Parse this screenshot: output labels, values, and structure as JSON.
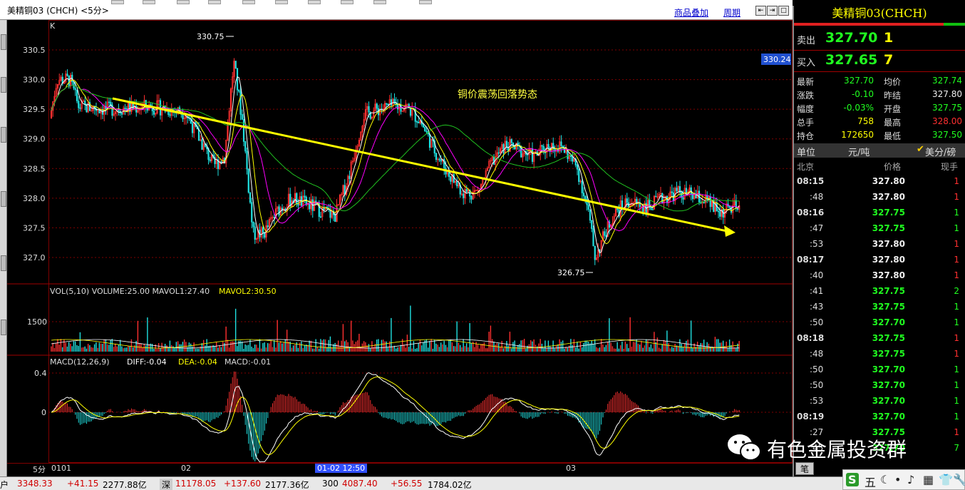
{
  "window": {
    "title": "美精铜03 (CHCH) <5分>",
    "links": [
      "商品叠加",
      "周期"
    ],
    "nav_buttons": [
      "⇤",
      "⇥",
      "□"
    ]
  },
  "chart": {
    "k_label": "K",
    "annotation_text": "铜价震荡回落势态",
    "high_label": "330.75",
    "low_label": "326.75",
    "current_price_tag": "330.24",
    "price_axis": [
      "330.5",
      "330.0",
      "329.5",
      "329.0",
      "328.5",
      "328.0",
      "327.5",
      "327.0"
    ],
    "vol_header": {
      "prefix": "VOL(5,10) VOLUME:25.00 MAVOL1:27.40",
      "mavol2": "MAVOL2:30.50"
    },
    "vol_axis": [
      "1500"
    ],
    "macd_header": {
      "prefix": "MACD(12,26,9)",
      "diff": "DIFF:-0.04",
      "dea": "DEA:-0.04",
      "macd": "MACD:-0.01"
    },
    "macd_axis": [
      "0.4",
      "0"
    ]
  },
  "x_axis": {
    "period": "5分",
    "labels": [
      "0101",
      "02",
      "03"
    ],
    "cursor": "01-02 12:50"
  },
  "quote": {
    "title": "美精铜03(CHCH)",
    "sell_label": "卖出",
    "sell_price": "327.70",
    "sell_qty": "1",
    "buy_label": "买入",
    "buy_price": "327.65",
    "buy_qty": "7",
    "rows": [
      {
        "l1": "最新",
        "v1": "327.70",
        "c1": "green",
        "l2": "均价",
        "v2": "327.74",
        "c2": "green"
      },
      {
        "l1": "涨跌",
        "v1": "-0.10",
        "c1": "green",
        "l2": "昨结",
        "v2": "327.80",
        "c2": "white"
      },
      {
        "l1": "幅度",
        "v1": "-0.03%",
        "c1": "green",
        "l2": "开盘",
        "v2": "327.75",
        "c2": "green"
      },
      {
        "l1": "总手",
        "v1": "758",
        "c1": "yellow",
        "l2": "最高",
        "v2": "328.00",
        "c2": "red"
      },
      {
        "l1": "持仓",
        "v1": "172650",
        "c1": "yellow",
        "l2": "最低",
        "v2": "327.50",
        "c2": "green"
      }
    ],
    "unit_label": "单位",
    "unit_value": "元/吨",
    "unit_alt": "美分/磅",
    "trade_header": {
      "loc": "北京",
      "price": "价格",
      "qty": "现手"
    },
    "trades": [
      {
        "t": "08:15",
        "bold": true,
        "p": "327.80",
        "pc": "white",
        "q": "1",
        "qc": "red"
      },
      {
        "t": ":48",
        "bold": false,
        "p": "327.80",
        "pc": "white",
        "q": "1",
        "qc": "red"
      },
      {
        "t": "08:16",
        "bold": true,
        "p": "327.75",
        "pc": "green",
        "q": "1",
        "qc": "green"
      },
      {
        "t": ":47",
        "bold": false,
        "p": "327.75",
        "pc": "green",
        "q": "1",
        "qc": "green"
      },
      {
        "t": ":53",
        "bold": false,
        "p": "327.80",
        "pc": "white",
        "q": "1",
        "qc": "red"
      },
      {
        "t": "08:17",
        "bold": true,
        "p": "327.80",
        "pc": "white",
        "q": "1",
        "qc": "red"
      },
      {
        "t": ":40",
        "bold": false,
        "p": "327.80",
        "pc": "white",
        "q": "1",
        "qc": "red"
      },
      {
        "t": ":41",
        "bold": false,
        "p": "327.75",
        "pc": "green",
        "q": "2",
        "qc": "green"
      },
      {
        "t": ":43",
        "bold": false,
        "p": "327.75",
        "pc": "green",
        "q": "1",
        "qc": "green"
      },
      {
        "t": ":50",
        "bold": false,
        "p": "327.70",
        "pc": "green",
        "q": "1",
        "qc": "green"
      },
      {
        "t": "08:18",
        "bold": true,
        "p": "327.75",
        "pc": "green",
        "q": "1",
        "qc": "red"
      },
      {
        "t": ":48",
        "bold": false,
        "p": "327.75",
        "pc": "green",
        "q": "1",
        "qc": "red"
      },
      {
        "t": ":50",
        "bold": false,
        "p": "327.70",
        "pc": "green",
        "q": "1",
        "qc": "green"
      },
      {
        "t": ":50",
        "bold": false,
        "p": "327.70",
        "pc": "green",
        "q": "1",
        "qc": "green"
      },
      {
        "t": ":53",
        "bold": false,
        "p": "327.70",
        "pc": "green",
        "q": "1",
        "qc": "green"
      },
      {
        "t": "08:19",
        "bold": true,
        "p": "327.70",
        "pc": "green",
        "q": "1",
        "qc": "green"
      },
      {
        "t": ":27",
        "bold": false,
        "p": "327.75",
        "pc": "green",
        "q": "1",
        "qc": "red"
      },
      {
        "t": ":45",
        "bold": false,
        "p": "327.70",
        "pc": "green",
        "q": "7",
        "qc": "green"
      }
    ],
    "tab_label": "笔"
  },
  "watermark": "有色金属投资群",
  "statusbar": {
    "sh_prefix": "户",
    "sh_price": "3348.33",
    "sh_change": "+41.15",
    "sh_amount": "2277.88亿",
    "sz_label": "深",
    "sz_price": "11178.05",
    "sz_change": "+137.60",
    "sz_amount": "2177.36亿",
    "hs_label": "300",
    "hs_price": "4087.40",
    "hs_change": "+56.55",
    "hs_amount": "1784.02亿"
  },
  "tray": {
    "items": [
      "五",
      "☾",
      "•",
      "♪",
      "▦",
      "👕",
      "🔧"
    ]
  },
  "colors": {
    "up": "#ff3030",
    "down": "#20e0e0",
    "ma5": "#ffffff",
    "ma10": "#ffff00",
    "ma20": "#ff00ff",
    "ma60": "#20c020",
    "trend": "#ffff00",
    "grid": "#800000"
  }
}
